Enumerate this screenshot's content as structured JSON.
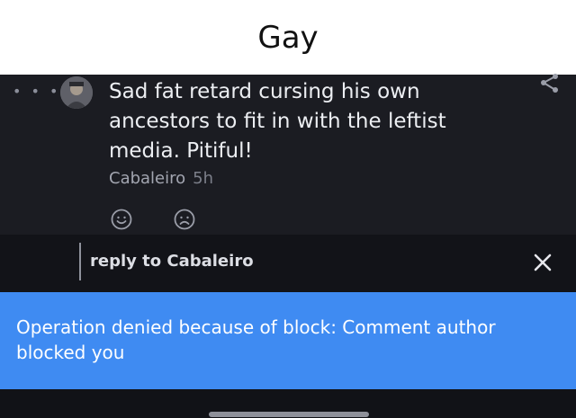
{
  "header": {
    "title": "Gay"
  },
  "comment": {
    "dots": "• • •",
    "text": "Sad fat retard cursing his own ancestors to fit in with the leftist media. Pitiful!",
    "author": "Cabaleiro",
    "time": "5h"
  },
  "icons": {
    "menu": "dots-menu-icon",
    "share": "share-icon",
    "like": "smiley-icon",
    "dislike": "frown-icon",
    "close": "close-icon"
  },
  "reply": {
    "label": "reply to Cabaleiro"
  },
  "banner": {
    "message": "Operation denied because of block: Comment author blocked you"
  },
  "colors": {
    "accent": "#3f8bf2",
    "background": "#1b1c22",
    "reply_bar": "#121318"
  }
}
